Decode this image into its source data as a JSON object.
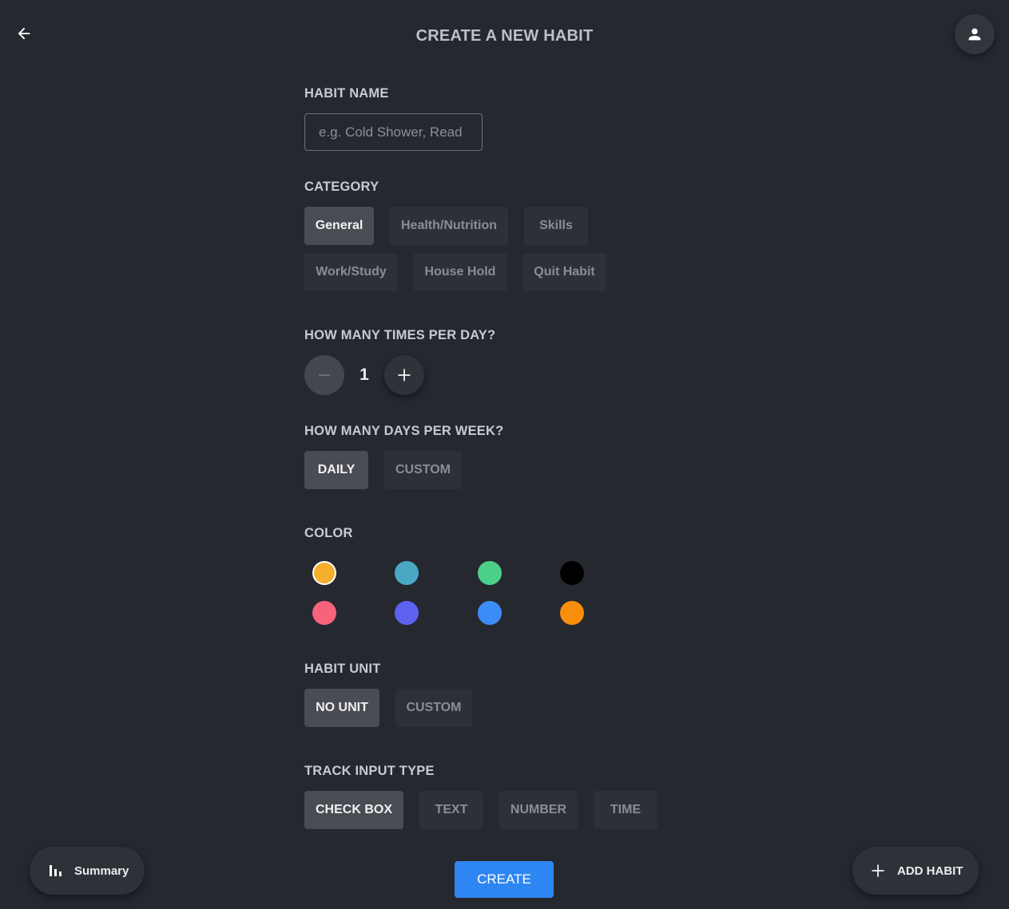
{
  "header": {
    "title": "CREATE A NEW HABIT",
    "back_icon": "arrow-left-icon",
    "account_icon": "person-icon"
  },
  "habit_name": {
    "label": "HABIT NAME",
    "value": "",
    "placeholder": "e.g. Cold Shower, Read"
  },
  "category": {
    "label": "CATEGORY",
    "options": [
      "General",
      "Health/Nutrition",
      "Skills",
      "Work/Study",
      "House Hold",
      "Quit Habit"
    ],
    "selected": "General"
  },
  "times_per_day": {
    "label": "HOW MANY TIMES PER DAY?",
    "value": "1",
    "minus_icon": "minus-icon",
    "plus_icon": "plus-icon"
  },
  "days_per_week": {
    "label": "HOW MANY DAYS PER WEEK?",
    "options": [
      "DAILY",
      "CUSTOM"
    ],
    "selected": "DAILY"
  },
  "color": {
    "label": "COLOR",
    "swatches": [
      "#f6ae2d",
      "#4aa8c5",
      "#4cd089",
      "#000000",
      "#f6637a",
      "#5e62f0",
      "#3b8cf6",
      "#f98d0c"
    ],
    "selected": "#f6ae2d"
  },
  "habit_unit": {
    "label": "HABIT UNIT",
    "options": [
      "NO UNIT",
      "CUSTOM"
    ],
    "selected": "NO UNIT"
  },
  "track_input_type": {
    "label": "TRACK INPUT TYPE",
    "options": [
      "CHECK BOX",
      "TEXT",
      "NUMBER",
      "TIME"
    ],
    "selected": "CHECK BOX"
  },
  "actions": {
    "create_label": "CREATE",
    "summary_label": "Summary",
    "summary_icon": "bar-chart-icon",
    "add_habit_label": "ADD HABIT",
    "add_habit_icon": "plus-icon"
  },
  "colors": {
    "background": "#262830",
    "accent": "#2e86f2",
    "chip_active": "#4a4c53",
    "chip_inactive": "#2e3037"
  }
}
